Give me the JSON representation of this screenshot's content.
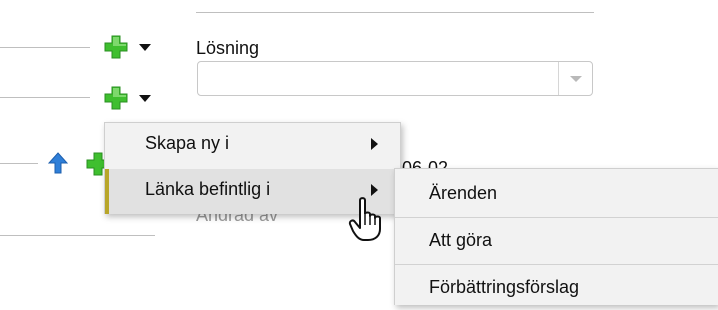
{
  "field": {
    "label": "Lösning",
    "value": ""
  },
  "background": {
    "date_fragment": "06-02",
    "partial_label": "Ändrad av"
  },
  "context_menu": {
    "items": [
      {
        "label": "Skapa ny i",
        "has_submenu": true
      },
      {
        "label": "Länka befintlig i",
        "has_submenu": true,
        "active": true
      }
    ]
  },
  "submenu": {
    "items": [
      {
        "label": "Ärenden"
      },
      {
        "label": "Att göra"
      },
      {
        "label": "Förbättringsförslag"
      }
    ]
  },
  "colors": {
    "plus_green": "#3fbf2f",
    "up_arrow_blue": "#2f7fd8",
    "menu_bg": "#f2f2f2",
    "accent": "#b8a62a"
  },
  "icons": [
    "plus-icon",
    "dropdown-caret-icon",
    "up-arrow-icon",
    "hand-pointer-cursor-icon"
  ]
}
